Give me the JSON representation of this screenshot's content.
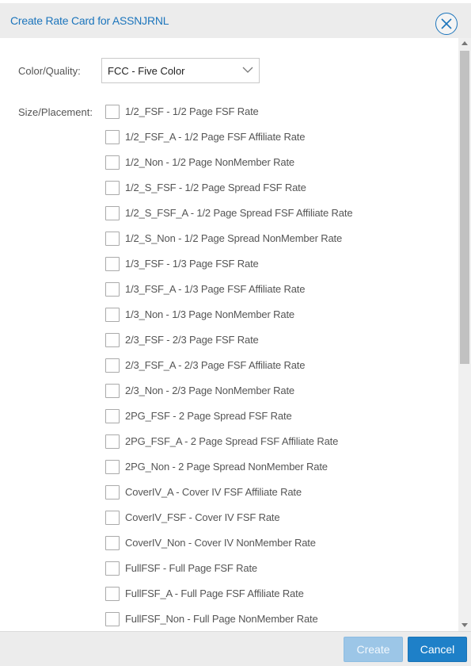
{
  "dialog": {
    "title": "Create Rate Card for ASSNJRNL"
  },
  "form": {
    "color_quality_label": "Color/Quality:",
    "color_quality_value": "FCC - Five Color",
    "size_placement_label": "Size/Placement:"
  },
  "size_options": [
    {
      "label": "1/2_FSF - 1/2 Page FSF Rate",
      "checked": false
    },
    {
      "label": "1/2_FSF_A - 1/2 Page FSF Affiliate Rate",
      "checked": false
    },
    {
      "label": "1/2_Non - 1/2 Page NonMember Rate",
      "checked": false
    },
    {
      "label": "1/2_S_FSF - 1/2 Page Spread FSF Rate",
      "checked": false
    },
    {
      "label": "1/2_S_FSF_A - 1/2 Page Spread FSF Affiliate Rate",
      "checked": false
    },
    {
      "label": "1/2_S_Non - 1/2 Page Spread NonMember Rate",
      "checked": false
    },
    {
      "label": "1/3_FSF - 1/3 Page FSF Rate",
      "checked": false
    },
    {
      "label": "1/3_FSF_A - 1/3 Page FSF Affiliate Rate",
      "checked": false
    },
    {
      "label": "1/3_Non - 1/3 Page NonMember Rate",
      "checked": false
    },
    {
      "label": "2/3_FSF - 2/3 Page FSF Rate",
      "checked": false
    },
    {
      "label": "2/3_FSF_A - 2/3 Page FSF Affiliate Rate",
      "checked": false
    },
    {
      "label": "2/3_Non - 2/3 Page NonMember Rate",
      "checked": false
    },
    {
      "label": "2PG_FSF - 2 Page Spread FSF Rate",
      "checked": false
    },
    {
      "label": "2PG_FSF_A - 2 Page Spread FSF Affiliate Rate",
      "checked": false
    },
    {
      "label": "2PG_Non - 2 Page Spread NonMember Rate",
      "checked": false
    },
    {
      "label": "CoverIV_A - Cover IV FSF Affiliate Rate",
      "checked": false
    },
    {
      "label": "CoverIV_FSF - Cover IV FSF Rate",
      "checked": false
    },
    {
      "label": "CoverIV_Non - Cover IV NonMember Rate",
      "checked": false
    },
    {
      "label": "FullFSF - Full Page FSF Rate",
      "checked": false
    },
    {
      "label": "FullFSF_A - Full Page FSF Affiliate Rate",
      "checked": false
    },
    {
      "label": "FullFSF_Non - Full Page NonMember Rate",
      "checked": false
    }
  ],
  "footer": {
    "create_label": "Create",
    "create_enabled": false,
    "cancel_label": "Cancel"
  },
  "icons": {
    "close": "close-circle-icon",
    "dropdown": "chevron-down-icon"
  },
  "colors": {
    "accent": "#1c75bc",
    "primary_button": "#1e80c8",
    "disabled_button": "#9cc6e7"
  }
}
